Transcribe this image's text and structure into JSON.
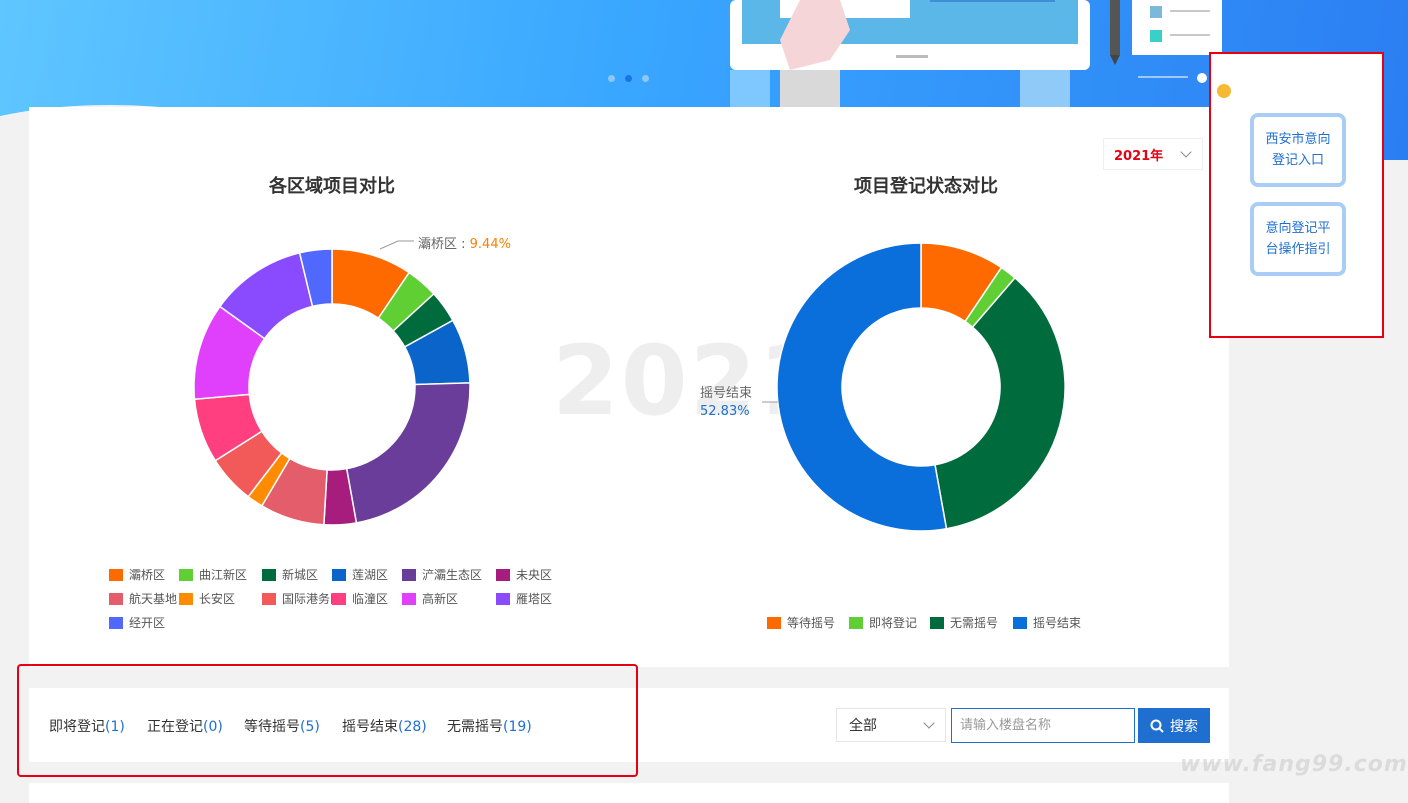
{
  "colors": {
    "accent": "#1f6fd1",
    "highlight_red": "#e60012",
    "callout_orange": "#ff7f00"
  },
  "banner": {
    "carousel_dots": 3,
    "active_dot": 1
  },
  "year_select": {
    "value": "2021年"
  },
  "watermark_year": "2021",
  "side_links": {
    "register_entry": "西安市意向登记入口",
    "guide": "意向登记平台操作指引"
  },
  "charts": {
    "left_title": "各区域项目对比",
    "right_title": "项目登记状态对比",
    "left_callout_label": "灞桥区 : ",
    "left_callout_value": "9.44%",
    "right_callout_label": "摇号结束",
    "right_callout_value": "52.83%"
  },
  "chart_data": [
    {
      "type": "pie",
      "variant": "donut",
      "title": "各区域项目对比",
      "unit": "%",
      "categories": [
        "灞桥区",
        "曲江新区",
        "新城区",
        "莲湖区",
        "浐灞生态区",
        "未央区",
        "航天基地",
        "长安区",
        "国际港务区",
        "临潼区",
        "高新区",
        "雁塔区",
        "经开区"
      ],
      "values": [
        9.44,
        3.77,
        3.77,
        7.55,
        22.64,
        3.77,
        7.55,
        1.89,
        5.66,
        7.55,
        11.32,
        11.32,
        3.77
      ],
      "colors": [
        "#ff6a00",
        "#5fcf34",
        "#006b3c",
        "#0a64c9",
        "#6a3d9a",
        "#a61d7e",
        "#e35d6a",
        "#ff8c00",
        "#f25a5a",
        "#ff3f80",
        "#e040fb",
        "#8a4bff",
        "#5168ff"
      ],
      "legend_position": "bottom"
    },
    {
      "type": "pie",
      "variant": "donut",
      "title": "项目登记状态对比",
      "unit": "%",
      "categories": [
        "等待摇号",
        "即将登记",
        "无需摇号",
        "摇号结束"
      ],
      "values": [
        9.43,
        1.89,
        35.85,
        52.83
      ],
      "colors": [
        "#ff6a00",
        "#5fcf34",
        "#006b3c",
        "#0a6edb"
      ],
      "legend_position": "bottom"
    }
  ],
  "status_tabs": [
    {
      "label": "即将登记",
      "count": "1"
    },
    {
      "label": "正在登记",
      "count": "0"
    },
    {
      "label": "等待摇号",
      "count": "5"
    },
    {
      "label": "摇号结束",
      "count": "28"
    },
    {
      "label": "无需摇号",
      "count": "19"
    }
  ],
  "search": {
    "type_select": "全部",
    "placeholder": "请输入楼盘名称",
    "button_label": "搜索"
  },
  "site_watermark": "www.fang99.com"
}
